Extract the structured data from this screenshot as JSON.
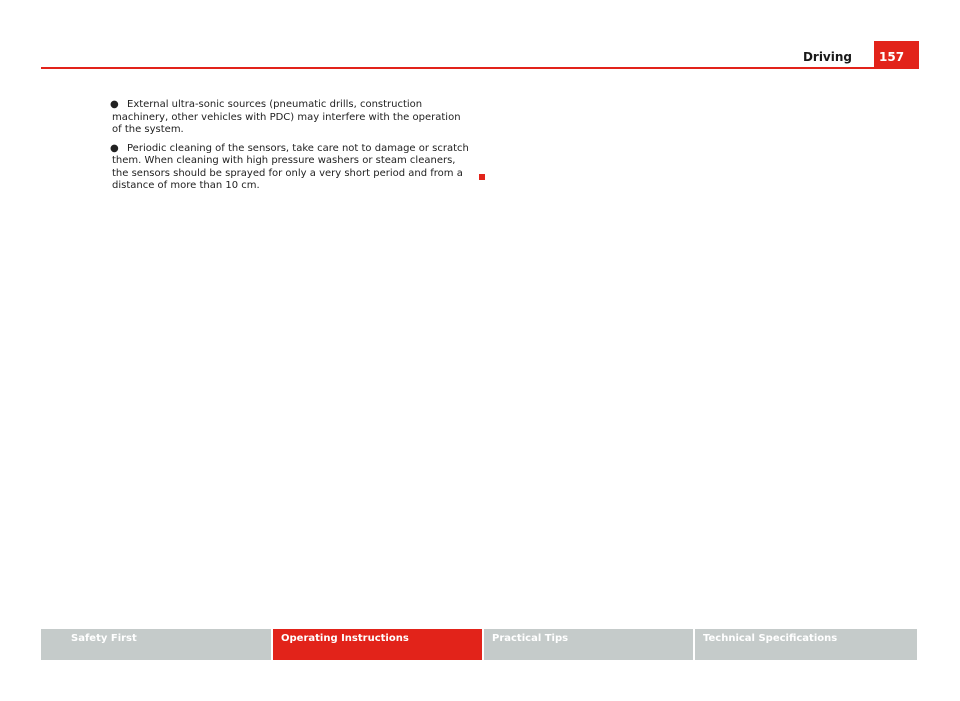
{
  "header": {
    "section_title": "Driving",
    "page_number": "157"
  },
  "content": {
    "bullets": [
      {
        "mark": "●",
        "text": "External ultra-sonic sources (pneumatic drills, construction machinery, other vehicles with PDC) may interfere with the operation of the system."
      },
      {
        "mark": "●",
        "text": "Periodic cleaning of the sensors, take care not to damage or scratch them. When cleaning with high pressure washers or steam cleaners, the sensors should be sprayed for only a very short period and from a distance of more than 10 cm."
      }
    ]
  },
  "footer": {
    "tabs": [
      {
        "label": "Safety First",
        "active": false
      },
      {
        "label": "Operating Instructions",
        "active": true
      },
      {
        "label": "Practical Tips",
        "active": false
      },
      {
        "label": "Technical Specifications",
        "active": false
      }
    ]
  },
  "colors": {
    "accent": "#e2231a",
    "tab_inactive": "#c5cbca"
  }
}
